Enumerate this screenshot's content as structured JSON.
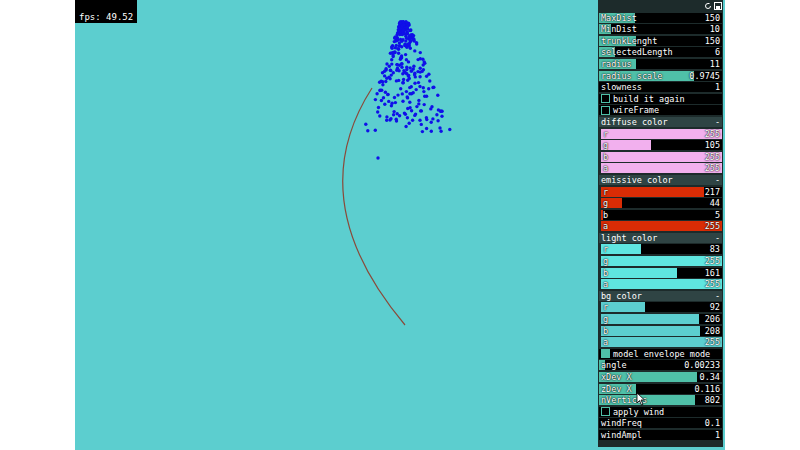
{
  "fps": "fps: 49.52",
  "top_controls": [
    {
      "kind": "slider",
      "label": "MaxDist",
      "value": "150",
      "level": 0.29
    },
    {
      "kind": "slider",
      "label": "MinDist",
      "value": "10",
      "level": 0.1
    },
    {
      "kind": "slider",
      "label": "trunkLenght",
      "value": "150",
      "level": 0.3
    },
    {
      "kind": "slider",
      "label": "selectedLength",
      "value": "6",
      "level": 0.13
    },
    {
      "kind": "slider",
      "label": "radius",
      "value": "11",
      "level": 0.3
    },
    {
      "kind": "slider",
      "label": "radius scale",
      "value": "0.9745",
      "level": 0.77
    },
    {
      "kind": "slider",
      "label": "slowness",
      "value": "1",
      "level": 0
    },
    {
      "kind": "toggle",
      "label": "build it again",
      "checked": false
    },
    {
      "kind": "toggle",
      "label": "wireFrame",
      "checked": false
    }
  ],
  "color_groups": [
    {
      "title": "diffuse color",
      "collapse": "-",
      "color": "#f2b0ee",
      "channels": [
        {
          "label": "r",
          "value": "255",
          "level": 1
        },
        {
          "label": "g",
          "value": "105",
          "level": 0.41
        },
        {
          "label": "b",
          "value": "255",
          "level": 1
        },
        {
          "label": "a",
          "value": "255",
          "level": 1
        }
      ]
    },
    {
      "title": "emissive color",
      "collapse": "-",
      "color": "#d92c05",
      "channels": [
        {
          "label": "r",
          "value": "217",
          "level": 0.85
        },
        {
          "label": "g",
          "value": "44",
          "level": 0.17
        },
        {
          "label": "b",
          "value": "5",
          "level": 0.02
        },
        {
          "label": "a",
          "value": "255",
          "level": 1
        }
      ]
    },
    {
      "title": "light color",
      "collapse": "-",
      "color": "#5fe6e0",
      "channels": [
        {
          "label": "r",
          "value": "83",
          "level": 0.33
        },
        {
          "label": "g",
          "value": "255",
          "level": 1
        },
        {
          "label": "b",
          "value": "161",
          "level": 0.63
        },
        {
          "label": "a",
          "value": "255",
          "level": 1
        }
      ]
    },
    {
      "title": "bg color",
      "collapse": "-",
      "color": "#5ccecf",
      "channels": [
        {
          "label": "r",
          "value": "92",
          "level": 0.36
        },
        {
          "label": "g",
          "value": "206",
          "level": 0.81
        },
        {
          "label": "b",
          "value": "208",
          "level": 0.82
        },
        {
          "label": "a",
          "value": "255",
          "level": 1
        }
      ]
    }
  ],
  "bottom_controls": [
    {
      "kind": "toggle",
      "label": "model envelope mode",
      "checked": true
    },
    {
      "kind": "slider",
      "label": "angle",
      "value": "0.00233",
      "level": 0.05
    },
    {
      "kind": "slider",
      "label": "xDev X",
      "value": "0.34",
      "level": 0.8
    },
    {
      "kind": "slider",
      "label": "zDev X",
      "value": "0.116",
      "level": 0.3
    },
    {
      "kind": "slider",
      "label": "nVertices",
      "value": "802",
      "level": 0.78
    },
    {
      "kind": "toggle",
      "label": "apply wind",
      "checked": false
    },
    {
      "kind": "slider",
      "label": "windFreq",
      "value": "0.1",
      "level": 0
    },
    {
      "kind": "slider",
      "label": "windAmpl",
      "value": "1",
      "level": 0
    }
  ]
}
